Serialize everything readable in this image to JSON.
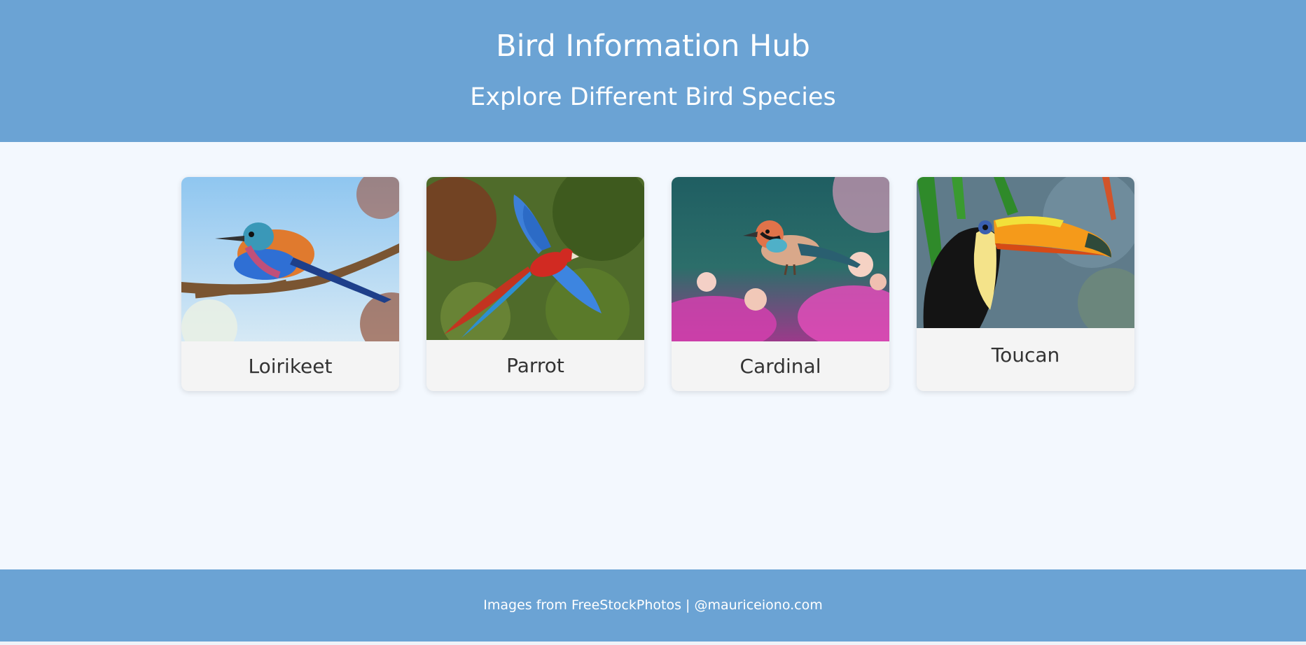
{
  "header": {
    "title": "Bird Information Hub",
    "subtitle": "Explore Different Bird Species"
  },
  "birds": [
    {
      "name": "Loirikeet"
    },
    {
      "name": "Parrot"
    },
    {
      "name": "Cardinal"
    },
    {
      "name": "Toucan"
    }
  ],
  "footer": {
    "source_text": "Images from FreeStockPhotos",
    "separator": " | ",
    "author": "@mauriceiono.com"
  },
  "colors": {
    "header_bg": "#6ba3d4",
    "page_bg": "#f3f8fe",
    "card_bg": "#f4f4f4",
    "text_dark": "#333333",
    "text_light": "#ffffff"
  }
}
